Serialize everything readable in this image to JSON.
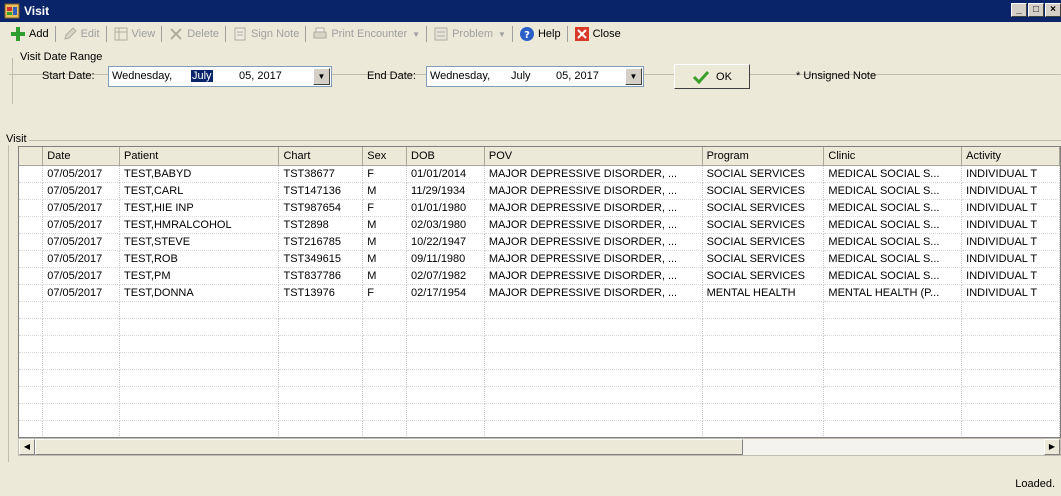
{
  "window": {
    "title": "Visit",
    "controls": [
      "_",
      "□",
      "×"
    ]
  },
  "toolbar": {
    "add": "Add",
    "edit": "Edit",
    "view": "View",
    "delete": "Delete",
    "sign_note": "Sign Note",
    "print_encounter": "Print Encounter",
    "problem": "Problem",
    "help": "Help",
    "close": "Close"
  },
  "date_range": {
    "group_label": "Visit Date Range",
    "start_label": "Start Date:",
    "start": {
      "weekday": "Wednesday,",
      "month": "July",
      "day_year": "05, 2017"
    },
    "end_label": "End Date:",
    "end": {
      "weekday": "Wednesday,",
      "month": "July",
      "day_year": "05, 2017"
    },
    "ok_label": "OK",
    "legend": "* Unsigned Note"
  },
  "visit_grid": {
    "group_label": "Visit",
    "columns": [
      "Date",
      "Patient",
      "Chart",
      "Sex",
      "DOB",
      "POV",
      "Program",
      "Clinic",
      "Activity"
    ],
    "rows": [
      [
        "07/05/2017",
        "TEST,BABYD",
        "TST38677",
        "F",
        "01/01/2014",
        "MAJOR DEPRESSIVE DISORDER, ...",
        "SOCIAL SERVICES",
        "MEDICAL SOCIAL S...",
        "INDIVIDUAL T"
      ],
      [
        "07/05/2017",
        "TEST,CARL",
        "TST147136",
        "M",
        "11/29/1934",
        "MAJOR DEPRESSIVE DISORDER, ...",
        "SOCIAL SERVICES",
        "MEDICAL SOCIAL S...",
        "INDIVIDUAL T"
      ],
      [
        "07/05/2017",
        "TEST,HIE INP",
        "TST987654",
        "F",
        "01/01/1980",
        "MAJOR DEPRESSIVE DISORDER, ...",
        "SOCIAL SERVICES",
        "MEDICAL SOCIAL S...",
        "INDIVIDUAL T"
      ],
      [
        "07/05/2017",
        "TEST,HMRALCOHOL",
        "TST2898",
        "M",
        "02/03/1980",
        "MAJOR DEPRESSIVE DISORDER, ...",
        "SOCIAL SERVICES",
        "MEDICAL SOCIAL S...",
        "INDIVIDUAL T"
      ],
      [
        "07/05/2017",
        "TEST,STEVE",
        "TST216785",
        "M",
        "10/22/1947",
        "MAJOR DEPRESSIVE DISORDER, ...",
        "SOCIAL SERVICES",
        "MEDICAL SOCIAL S...",
        "INDIVIDUAL T"
      ],
      [
        "07/05/2017",
        "TEST,ROB",
        "TST349615",
        "M",
        "09/11/1980",
        "MAJOR DEPRESSIVE DISORDER, ...",
        "SOCIAL SERVICES",
        "MEDICAL SOCIAL S...",
        "INDIVIDUAL T"
      ],
      [
        "07/05/2017",
        "TEST,PM",
        "TST837786",
        "M",
        "02/07/1982",
        "MAJOR DEPRESSIVE DISORDER, ...",
        "SOCIAL SERVICES",
        "MEDICAL SOCIAL S...",
        "INDIVIDUAL T"
      ],
      [
        "07/05/2017",
        "TEST,DONNA",
        "TST13976",
        "F",
        "02/17/1954",
        "MAJOR DEPRESSIVE DISORDER, ...",
        "MENTAL HEALTH",
        "MENTAL HEALTH (P...",
        "INDIVIDUAL T"
      ]
    ],
    "empty_rows": 9
  },
  "status": {
    "text": "Loaded."
  },
  "colors": {
    "titlebar": "#0a246a",
    "window_bg": "#ece9d8",
    "selection": "#0a246a"
  }
}
